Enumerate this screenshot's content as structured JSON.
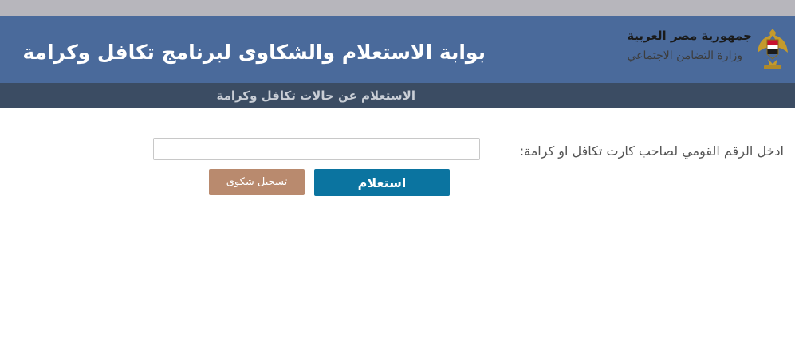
{
  "header": {
    "portal_title": "بوابة الاستعلام والشكاوى لبرنامج تكافل وكرامة",
    "country_name": "جمهورية مصر العربية",
    "ministry_name": "وزارة التضامن الاجتماعي"
  },
  "nav": {
    "inquiry_link": "الاستعلام عن حالات تكافل وكرامة"
  },
  "form": {
    "field_label": "ادخل الرقم القومي لصاحب كارت تكافل او كرامة:",
    "national_id_value": "",
    "inquire_label": "استعلام",
    "complaint_label": "تسجيل شكوى"
  },
  "colors": {
    "header_bg": "#4a6a9b",
    "subnav_bg": "#3b4c63",
    "inquire_button": "#0b74a0",
    "complaint_button": "#b98a6e"
  }
}
